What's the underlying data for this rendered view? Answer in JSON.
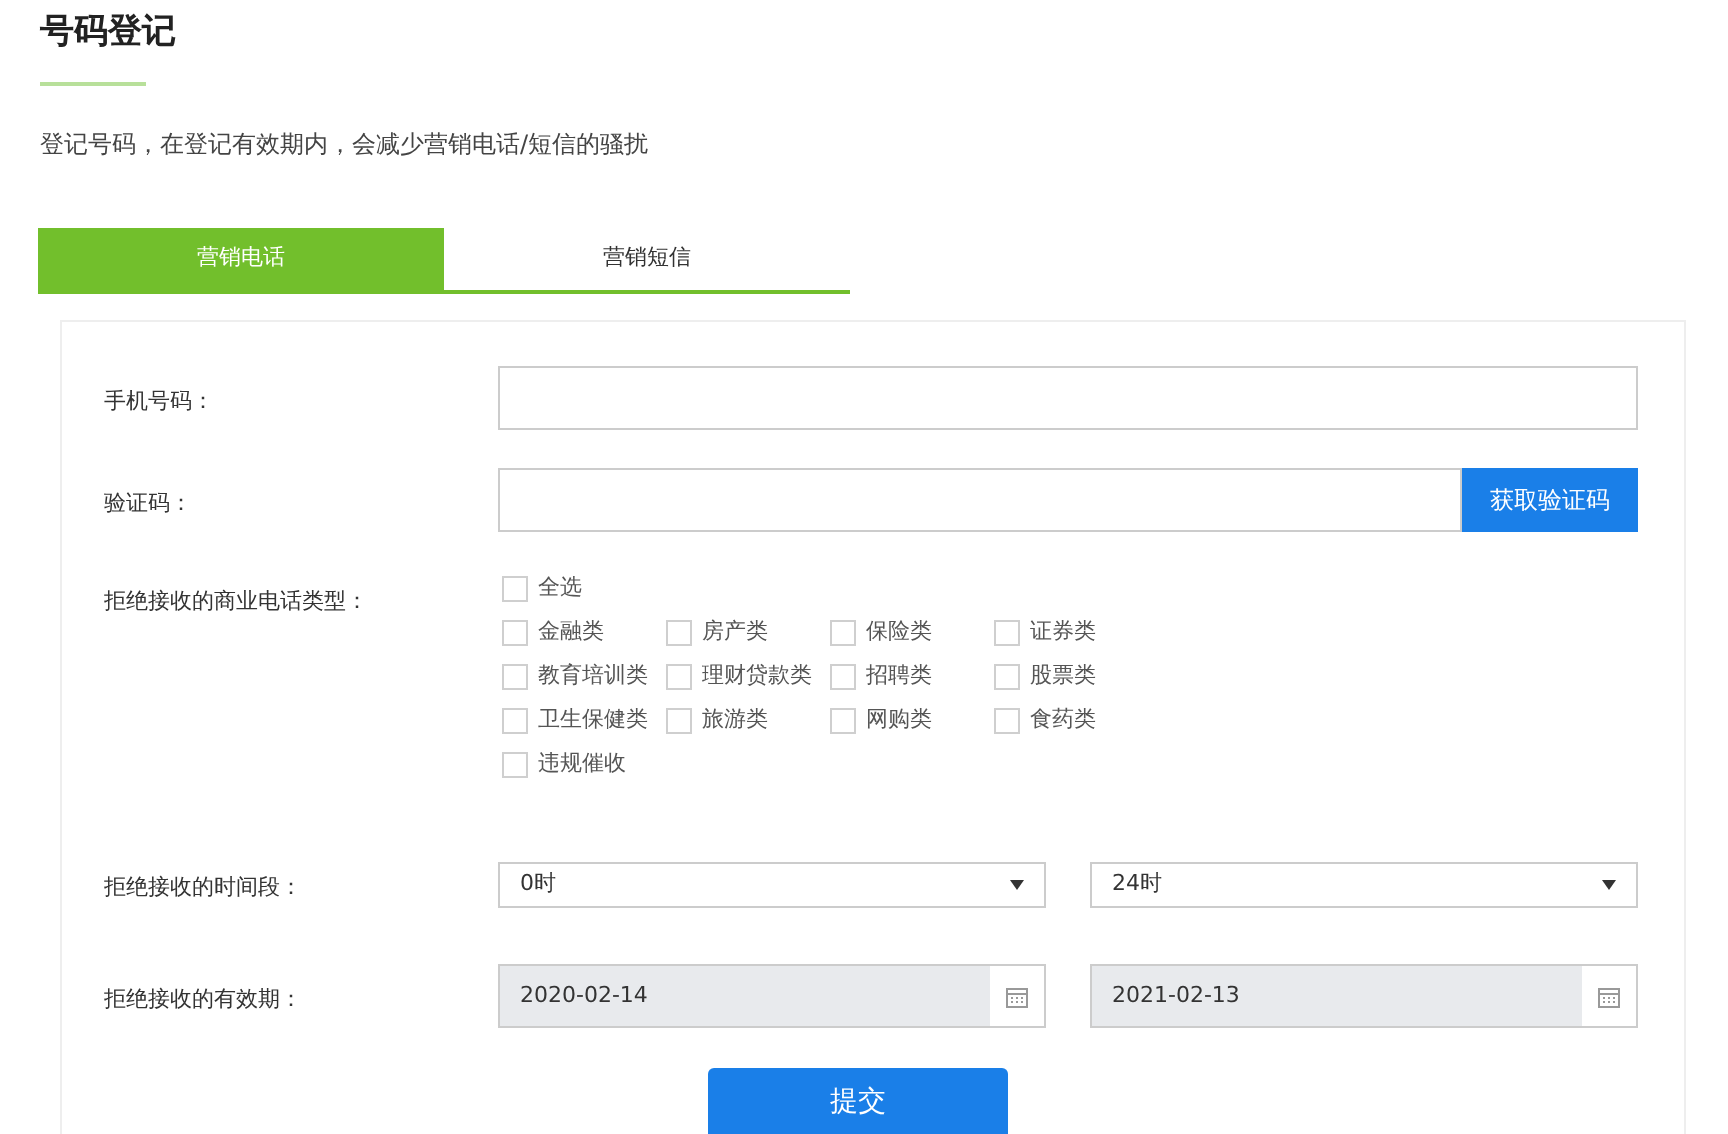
{
  "title": "号码登记",
  "description": "登记号码，在登记有效期内，会减少营销电话/短信的骚扰",
  "tabs": [
    {
      "label": "营销电话",
      "selected": true
    },
    {
      "label": "营销短信",
      "selected": false
    }
  ],
  "phone": {
    "label": "手机号码："
  },
  "code": {
    "label": "验证码：",
    "button": "获取验证码"
  },
  "categories": {
    "label": "拒绝接收的商业电话类型：",
    "select_all": {
      "label": "全选",
      "checked": false
    },
    "items": [
      {
        "label": "金融类",
        "checked": false
      },
      {
        "label": "房产类",
        "checked": false
      },
      {
        "label": "保险类",
        "checked": false
      },
      {
        "label": "证券类",
        "checked": false
      },
      {
        "label": "教育培训类",
        "checked": false
      },
      {
        "label": "理财贷款类",
        "checked": false
      },
      {
        "label": "招聘类",
        "checked": false
      },
      {
        "label": "股票类",
        "checked": false
      },
      {
        "label": "卫生保健类",
        "checked": false
      },
      {
        "label": "旅游类",
        "checked": false
      },
      {
        "label": "网购类",
        "checked": false
      },
      {
        "label": "食药类",
        "checked": false
      },
      {
        "label": "违规催收",
        "checked": false
      }
    ]
  },
  "time_range": {
    "label": "拒绝接收的时间段：",
    "from": "0时",
    "to": "24时"
  },
  "validity": {
    "label": "拒绝接收的有效期：",
    "from": "2020-02-14",
    "to": "2021-02-13"
  },
  "submit": "提交"
}
